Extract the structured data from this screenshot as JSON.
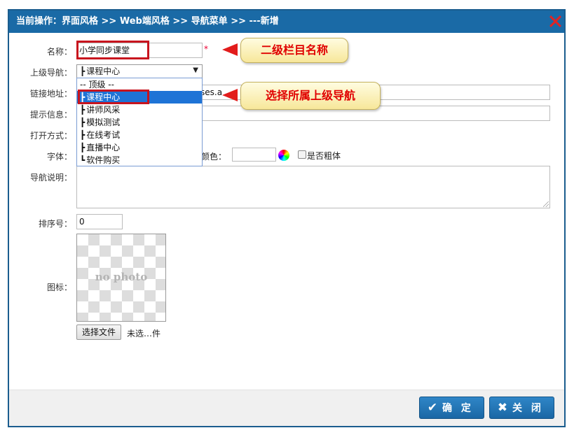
{
  "title": "当前操作：界面风格 >> Web端风格 >> 导航菜单 >> ---新增",
  "form": {
    "name_label": "名称：",
    "name_value": "小学同步课堂",
    "required_mark": "*",
    "parent_label": "上级导航：",
    "parent_value": "课程中心",
    "link_label": "链接地址：",
    "link_value": "ses.a",
    "tip_label": "提示信息：",
    "open_label": "打开方式：",
    "font_label": "字体：",
    "color_label": "颜色：",
    "bold_label": "是否粗体",
    "desc_label": "导航说明：",
    "order_label": "排序号：",
    "order_value": "0",
    "icon_label": "图标：",
    "photo_placeholder": "no photo",
    "file_button": "选择文件",
    "file_status": "未选…件"
  },
  "dropdown": {
    "options": [
      {
        "prefix": "",
        "label": "-- 顶级 --"
      },
      {
        "prefix": "┣",
        "label": "课程中心"
      },
      {
        "prefix": "┣",
        "label": "讲师风采"
      },
      {
        "prefix": "┣",
        "label": "模拟测试"
      },
      {
        "prefix": "┣",
        "label": "在线考试"
      },
      {
        "prefix": "┣",
        "label": "直播中心"
      },
      {
        "prefix": "┗",
        "label": "软件购买"
      }
    ],
    "selected_index": 1
  },
  "callouts": {
    "name": "二级栏目名称",
    "parent": "选择所属上级导航"
  },
  "footer": {
    "confirm_label": "确 定",
    "confirm_icon": "check-icon",
    "close_label": "关 闭",
    "close_icon": "cross-icon"
  },
  "colors": {
    "titlebar": "#1a6aa6",
    "accent": "#1b67a5",
    "annotation": "#c8141e"
  }
}
